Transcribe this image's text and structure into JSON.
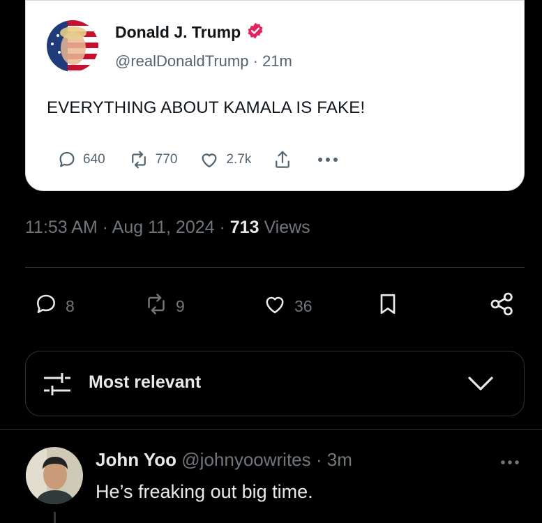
{
  "post": {
    "author_name": "Donald J. Trump",
    "author_handle": "@realDonaldTrump",
    "separator": "·",
    "time_ago": "21m",
    "text": "EVERYTHING ABOUT KAMALA IS FAKE!",
    "replies": "640",
    "reposts": "770",
    "likes": "2.7k",
    "verified_color": "#e0245e"
  },
  "meta": {
    "time": "11:53 AM",
    "sep1": "·",
    "date": "Aug 11, 2024",
    "sep2": "·",
    "views_count": "713",
    "views_label": "Views"
  },
  "engagement": {
    "replies": "8",
    "reposts": "9",
    "likes": "36"
  },
  "sort": {
    "label": "Most relevant"
  },
  "reply": {
    "name": "John Yoo",
    "handle": "@johnyoowrites",
    "separator": "·",
    "time_ago": "3m",
    "text": "He’s freaking out big time."
  },
  "colors": {
    "background": "#000000",
    "card": "#ffffff",
    "muted": "#71767b",
    "text": "#e7e9ea",
    "border": "#2f3336"
  },
  "icons": [
    "reply-icon",
    "repost-icon",
    "like-icon",
    "share-icon",
    "more-icon",
    "bookmark-icon",
    "share-network-icon",
    "filter-icon",
    "chevron-down-icon",
    "verified-badge-icon"
  ]
}
